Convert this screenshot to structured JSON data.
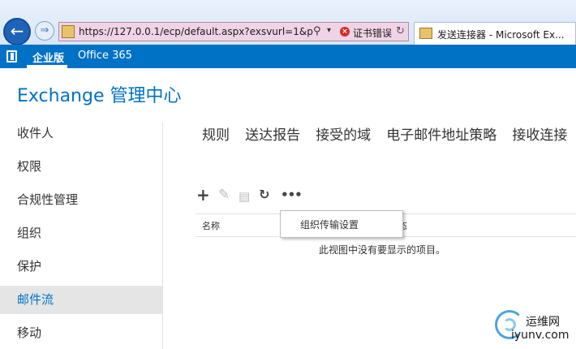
{
  "browser": {
    "url": "https://127.0.0.1/ecp/default.aspx?exsvurl=1&p=",
    "cert_error": "证书错误",
    "tab_title": "发送连接器 - Microsoft Ex..."
  },
  "office_bar": {
    "enterprise": "企业版",
    "office365": "Office 365",
    "color": "#0072c6"
  },
  "app": {
    "title": "Exchange 管理中心"
  },
  "left_nav": {
    "items": [
      {
        "label": "收件人",
        "active": false
      },
      {
        "label": "权限",
        "active": false
      },
      {
        "label": "合规性管理",
        "active": false
      },
      {
        "label": "组织",
        "active": false
      },
      {
        "label": "保护",
        "active": false
      },
      {
        "label": "邮件流",
        "active": true
      },
      {
        "label": "移动",
        "active": false
      }
    ]
  },
  "tabs": [
    "规则",
    "送达报告",
    "接受的域",
    "电子邮件地址策略",
    "接收连接"
  ],
  "toolbar": {
    "icons": [
      "plus-icon",
      "edit-icon",
      "delete-icon",
      "refresh-icon",
      "more-icon"
    ]
  },
  "table": {
    "columns": [
      "名称",
      "态"
    ],
    "empty_message": "此视图中没有要显示的项目。"
  },
  "dropdown": {
    "item": "组织传输设置"
  },
  "watermark": {
    "top": "运维网",
    "bottom": "iyunv.com"
  }
}
